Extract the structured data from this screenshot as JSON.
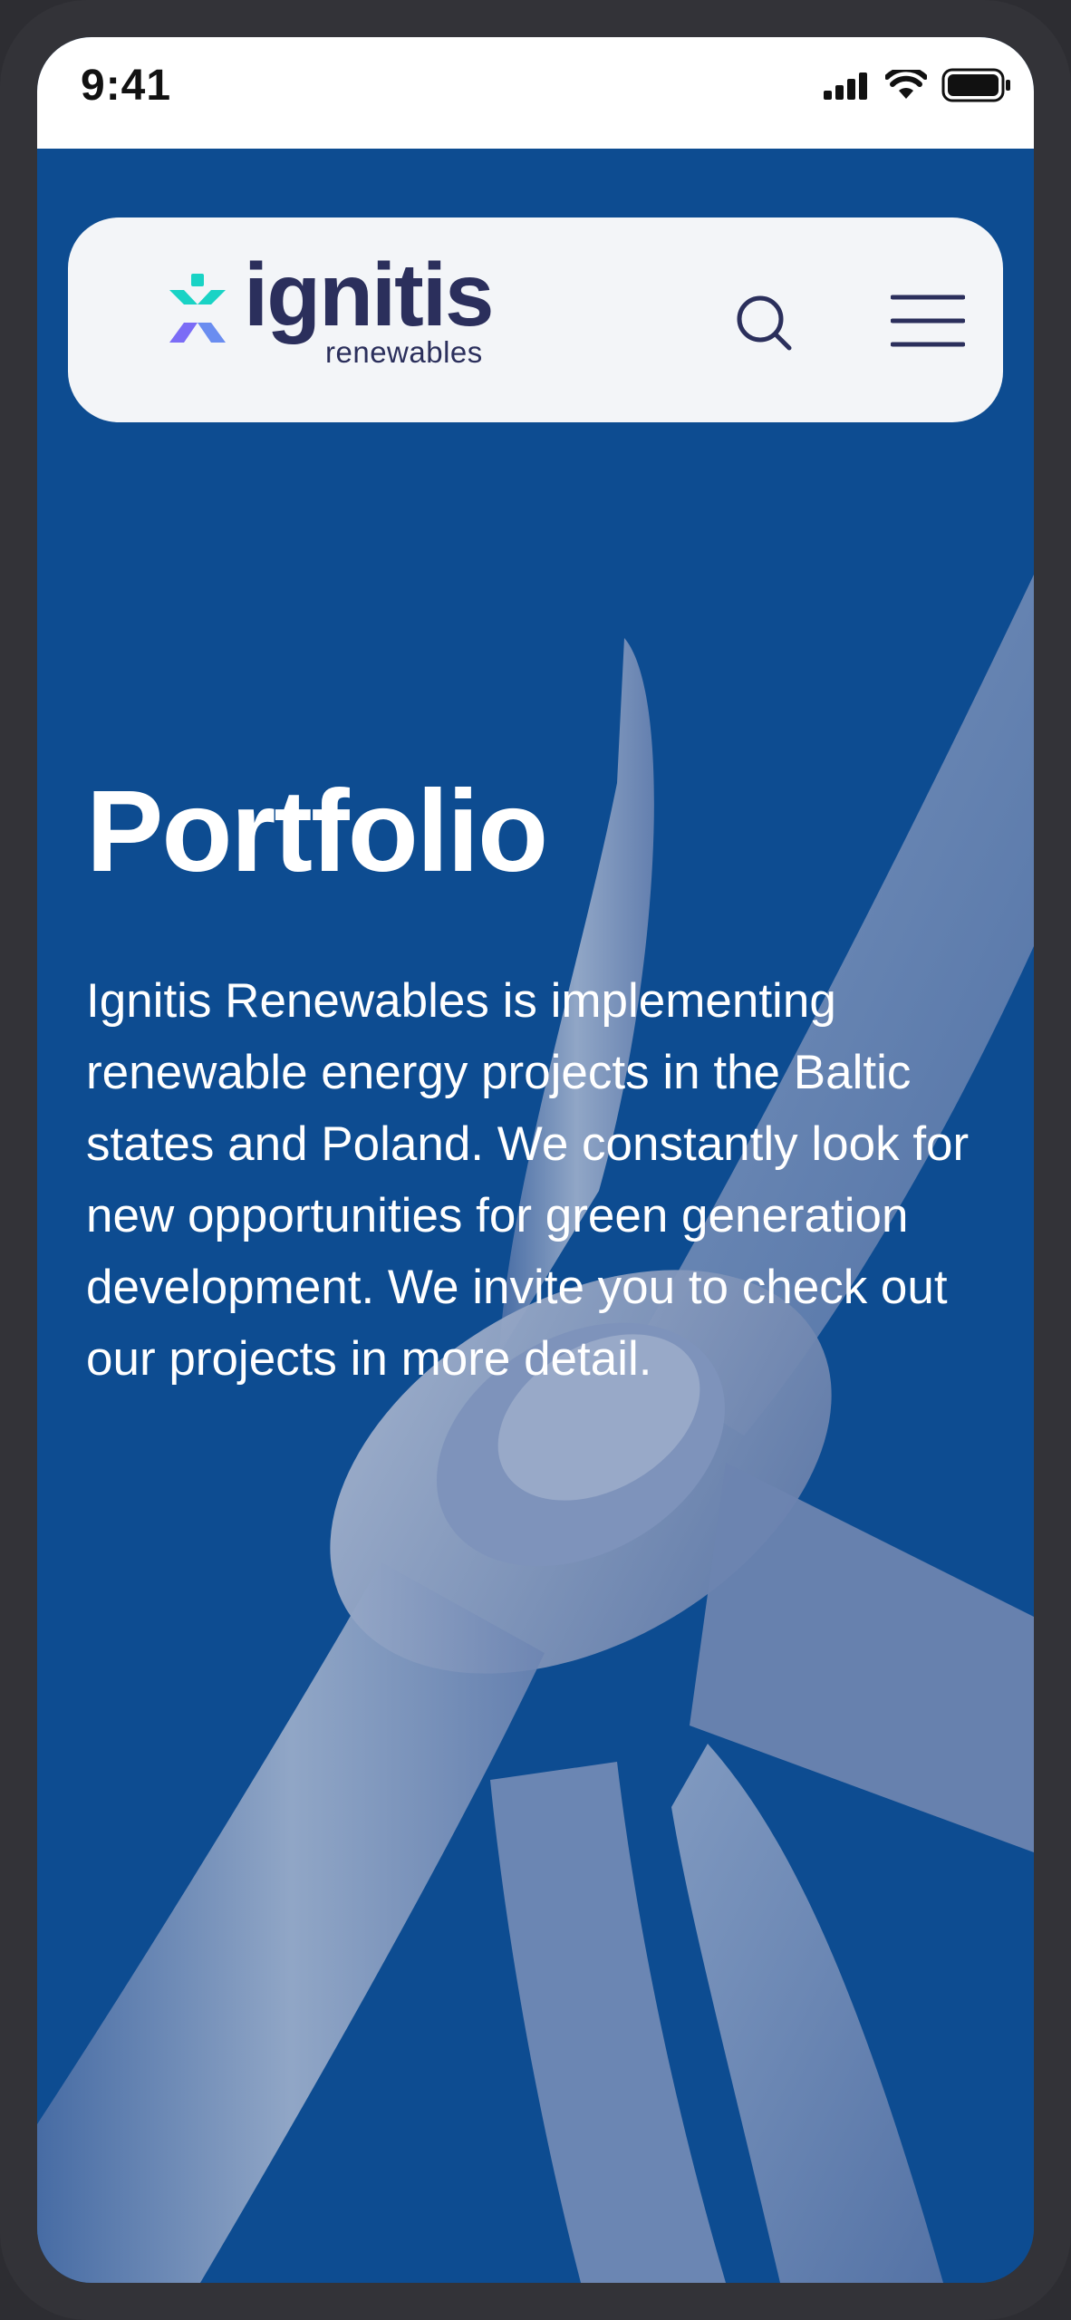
{
  "status_bar": {
    "time": "9:41",
    "icons": [
      "cellular-signal-icon",
      "wifi-icon",
      "battery-icon"
    ]
  },
  "header": {
    "logo": {
      "word": "ignitis",
      "sub": "renewables"
    },
    "search_icon": "search-icon",
    "menu_icon": "hamburger-menu-icon"
  },
  "hero": {
    "title": "Portfolio",
    "description": "Ignitis Renewables is implementing renewable energy projects in the Baltic states and Poland. We constantly look for new opportunities for green generation development. We invite you to check out our projects in more detail.",
    "background_image": "wind-turbine-hub-and-blades"
  },
  "colors": {
    "hero_blue": "#0d4c91",
    "header_bg": "#f3f5f8",
    "logo_navy": "#2b2f5c",
    "logo_teal": "#19d3c5",
    "logo_purple": "#7b6cf6",
    "text_white": "#ffffff"
  }
}
